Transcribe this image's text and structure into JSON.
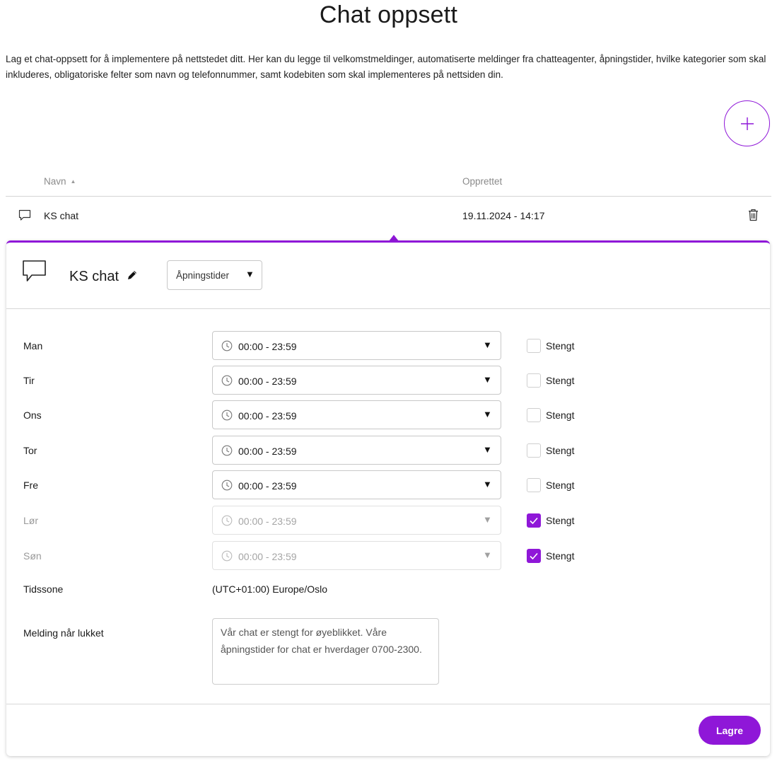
{
  "page": {
    "title": "Chat oppsett",
    "intro": "Lag et chat-oppsett for å implementere på nettstedet ditt. Her kan du legge til velkomstmeldinger, automatiserte meldinger fra chatteagenter, åpningstider, hvilke kategorier som skal inkluderes, obligatoriske felter som navn og telefonnummer, samt kodebiten som skal implementeres på nettsiden din."
  },
  "add_button": {
    "icon": "plus-icon"
  },
  "table": {
    "columns": {
      "name": "Navn",
      "created": "Opprettet"
    },
    "sort": {
      "column": "name",
      "direction": "ascending"
    },
    "rows": [
      {
        "name": "KS chat",
        "created": "19.11.2024 - 14:17",
        "icon": "chat-bubble-icon",
        "action_icon": "trash-icon"
      }
    ]
  },
  "panel": {
    "title": "KS chat",
    "view_select": {
      "selected": "Åpningstider"
    },
    "hours": [
      {
        "day": "Man",
        "time": "00:00 - 23:59",
        "closed": false,
        "closed_label": "Stengt"
      },
      {
        "day": "Tir",
        "time": "00:00 - 23:59",
        "closed": false,
        "closed_label": "Stengt"
      },
      {
        "day": "Ons",
        "time": "00:00 - 23:59",
        "closed": false,
        "closed_label": "Stengt"
      },
      {
        "day": "Tor",
        "time": "00:00 - 23:59",
        "closed": false,
        "closed_label": "Stengt"
      },
      {
        "day": "Fre",
        "time": "00:00 - 23:59",
        "closed": false,
        "closed_label": "Stengt"
      },
      {
        "day": "Lør",
        "time": "00:00 - 23:59",
        "closed": true,
        "closed_label": "Stengt"
      },
      {
        "day": "Søn",
        "time": "00:00 - 23:59",
        "closed": true,
        "closed_label": "Stengt"
      }
    ],
    "timezone": {
      "label": "Tidssone",
      "value": "(UTC+01:00) Europe/Oslo"
    },
    "closed_message": {
      "label": "Melding når lukket",
      "value": "Vår chat er stengt for øyeblikket. Våre åpningstider for chat er hverdager 0700-2300."
    },
    "save_label": "Lagre"
  },
  "colors": {
    "accent": "#8f17d8",
    "border": "#c8c8c8",
    "muted_text": "#9a9a9a"
  }
}
